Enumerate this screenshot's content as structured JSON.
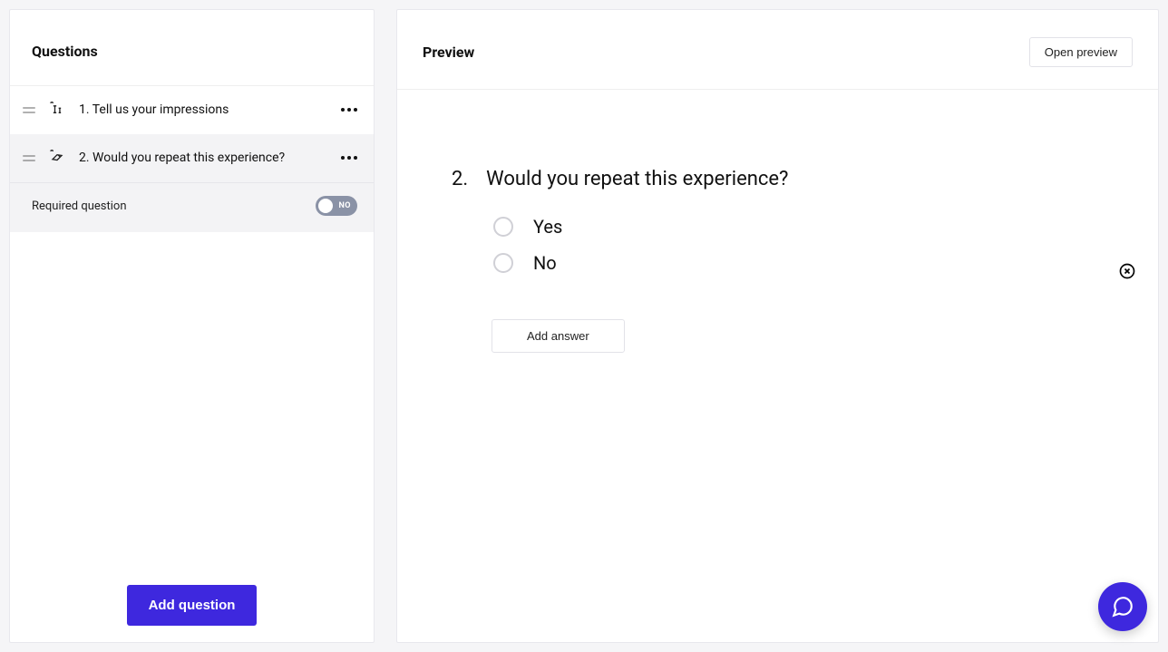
{
  "left": {
    "header": "Questions",
    "questions": [
      {
        "label": "1. Tell us your impressions"
      },
      {
        "label": "2. Would you repeat this experience?"
      }
    ],
    "required_label": "Required question",
    "toggle_text": "NO",
    "add_question": "Add question"
  },
  "right": {
    "header": "Preview",
    "open_preview": "Open preview",
    "q_number": "2.",
    "q_text": "Would you repeat this experience?",
    "answers": [
      "Yes",
      "No"
    ],
    "add_answer": "Add answer"
  }
}
